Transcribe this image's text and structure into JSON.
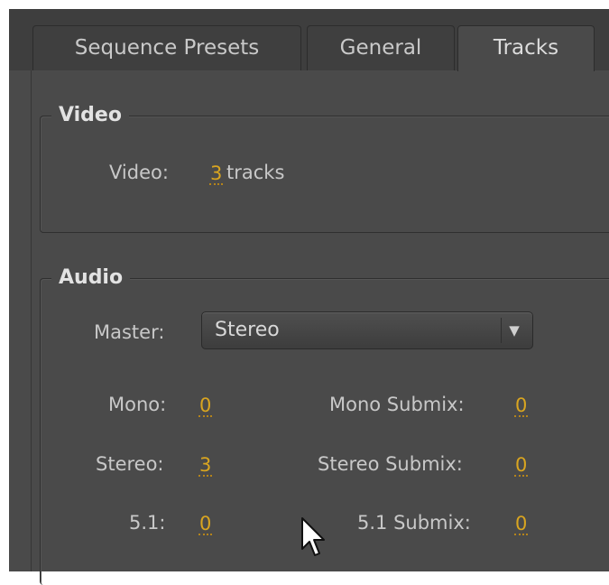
{
  "tabs": [
    {
      "label": "Sequence Presets",
      "active": false
    },
    {
      "label": "General",
      "active": false
    },
    {
      "label": "Tracks",
      "active": true
    }
  ],
  "video": {
    "title": "Video",
    "label": "Video:",
    "value": "3",
    "suffix": "tracks"
  },
  "audio": {
    "title": "Audio",
    "master_label": "Master:",
    "master_value": "Stereo",
    "mono_label": "Mono:",
    "mono_value": "0",
    "mono_submix_label": "Mono Submix:",
    "mono_submix_value": "0",
    "stereo_label": "Stereo:",
    "stereo_value": "3",
    "stereo_submix_label": "Stereo Submix:",
    "stereo_submix_value": "0",
    "surround_label": "5.1:",
    "surround_value": "0",
    "surround_submix_label": "5.1 Submix:",
    "surround_submix_value": "0"
  },
  "colors": {
    "panel_bg": "#4a4a4a",
    "value_accent": "#d9a520"
  },
  "icons": {
    "dropdown": "chevron-down-icon",
    "cursor": "mouse-pointer-icon"
  }
}
